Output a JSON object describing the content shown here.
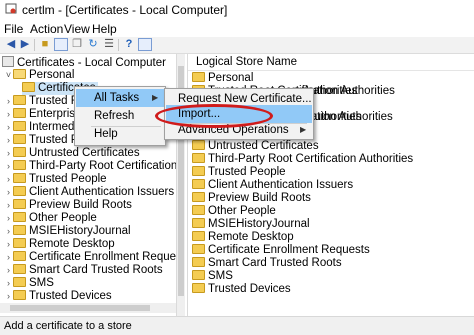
{
  "window": {
    "title": "certlm - [Certificates - Local Computer]"
  },
  "menu": [
    "File",
    "Action",
    "View",
    "Help"
  ],
  "toolbar": {
    "icons": [
      "back-arrow-icon",
      "forward-arrow-icon",
      "up-folder-icon",
      "console-tree-icon",
      "copy-icon",
      "refresh-icon",
      "export-list-icon",
      "help-icon",
      "properties-icon"
    ]
  },
  "tree": {
    "root": "Certificates - Local Computer",
    "personal": "Personal",
    "certificates": "Certificates",
    "items": [
      "Trusted Root",
      "Enterprise Tr",
      "Intermediat",
      "Trusted Pub",
      "Untrusted Certificates",
      "Third-Party Root Certification Authoriti",
      "Trusted People",
      "Client Authentication Issuers",
      "Preview Build Roots",
      "Other People",
      "MSIEHistoryJournal",
      "Remote Desktop",
      "Certificate Enrollment Requests",
      "Smart Card Trusted Roots",
      "SMS",
      "Trusted Devices"
    ]
  },
  "list": {
    "header": "Logical Store Name",
    "items": [
      "Personal",
      "Trusted Root Certification Authorities",
      "",
      "Intermediate Certification Authorities",
      "",
      "Untrusted Certificates",
      "Third-Party Root Certification Authorities",
      "Trusted People",
      "Client Authentication Issuers",
      "Preview Build Roots",
      "Other People",
      "MSIEHistoryJournal",
      "Remote Desktop",
      "Certificate Enrollment Requests",
      "Smart Card Trusted Roots",
      "SMS",
      "Trusted Devices"
    ],
    "partial": {
      "row1_tail": "Authorities",
      "row3_tail": "Authorities"
    }
  },
  "context_menu": {
    "items": [
      "All Tasks",
      "Refresh",
      "Help"
    ]
  },
  "submenu": {
    "items": [
      "Request New Certificate...",
      "Import...",
      "Advanced Operations"
    ]
  },
  "status": "Add a certificate to a store",
  "colors": {
    "selection": "#cce4f7",
    "menu_highlight": "#91c9f7",
    "annotation_circle": "#d01b1b",
    "folder": "#f4cc52"
  }
}
